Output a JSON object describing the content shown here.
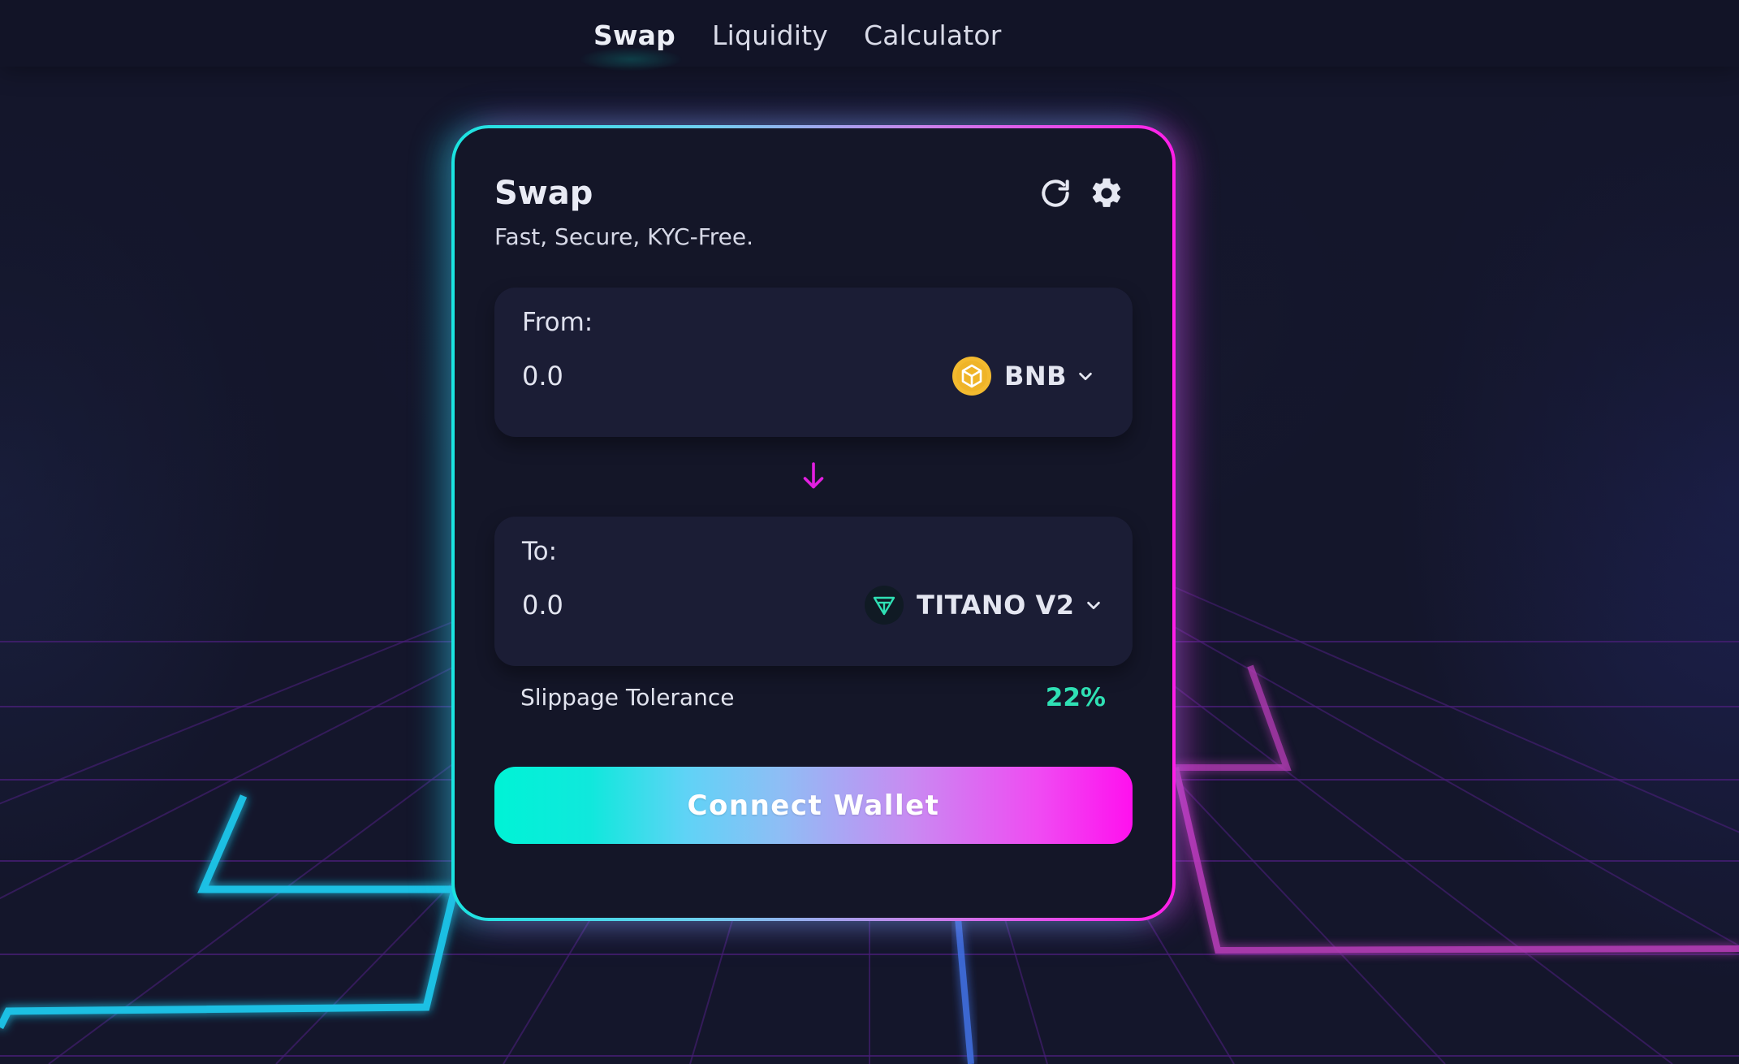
{
  "nav": {
    "tabs": [
      {
        "label": "Swap",
        "active": true
      },
      {
        "label": "Liquidity",
        "active": false
      },
      {
        "label": "Calculator",
        "active": false
      }
    ]
  },
  "card": {
    "title": "Swap",
    "subtitle": "Fast, Secure, KYC-Free.",
    "icons": [
      "refresh-icon",
      "gear-icon"
    ]
  },
  "from": {
    "label": "From:",
    "value": "0.0",
    "token": {
      "symbol": "BNB",
      "icon": "bnb-token-icon",
      "color": "#F3BA2F"
    }
  },
  "to": {
    "label": "To:",
    "value": "0.0",
    "token": {
      "symbol": "TITANO V2",
      "icon": "titano-token-icon",
      "color": "#2fe0b4"
    }
  },
  "swap_direction_icon": "arrow-down-icon",
  "slippage": {
    "label": "Slippage Tolerance",
    "value": "22%"
  },
  "connect_button": {
    "label": "Connect Wallet"
  },
  "colors": {
    "background": "#14162b",
    "card": "#141628",
    "panel": "#1b1d35",
    "accent_cyan": "#00f3d6",
    "accent_magenta": "#ff10ee",
    "slippage_green": "#2fe0b4"
  }
}
